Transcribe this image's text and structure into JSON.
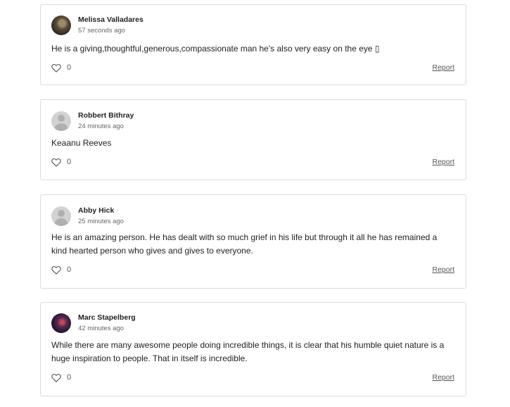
{
  "comments": [
    {
      "author": "Melissa Valladares",
      "time": "57 seconds ago",
      "text": "He is a giving,thoughtful,generous,compassionate man he's also very easy on the eye ▯",
      "likes": "0",
      "report_label": "Report",
      "avatar": "photo-avatar"
    },
    {
      "author": "Robbert Bithray",
      "time": "24 minutes ago",
      "text": "Keaanu Reeves",
      "likes": "0",
      "report_label": "Report",
      "avatar": "default-avatar"
    },
    {
      "author": "Abby Hick",
      "time": "25 minutes ago",
      "text": "He is an amazing person. He has dealt with so much grief in his life but through it all he has remained a kind hearted person who gives and gives to everyone.",
      "likes": "0",
      "report_label": "Report",
      "avatar": "default-avatar"
    },
    {
      "author": "Marc Stapelberg",
      "time": "42 minutes ago",
      "text": "While there are many awesome people doing incredible things, it is clear that his humble quiet nature is a huge inspiration to people. That in itself is incredible.",
      "likes": "0",
      "report_label": "Report",
      "avatar": "photo-avatar"
    }
  ],
  "colors": {
    "border": "#dcdcdc",
    "text": "#222222",
    "muted": "#666666"
  },
  "icons": {
    "like": "heart-outline-icon"
  }
}
